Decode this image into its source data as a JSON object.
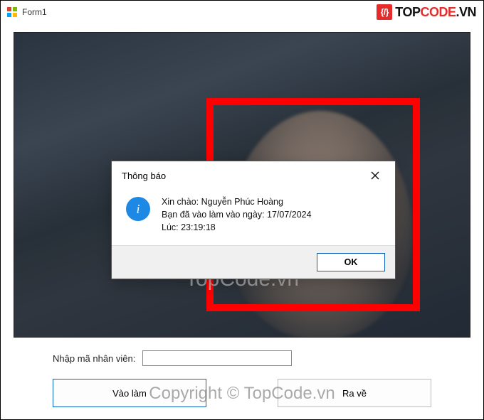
{
  "window": {
    "title": "Form1"
  },
  "brand": {
    "logo_glyph": "{/}",
    "name_part1": "TOP",
    "name_part2": "CODE",
    "name_suffix": ".VN"
  },
  "watermarks": {
    "center": "TopCode.vn",
    "footer": "Copyright © TopCode.vn"
  },
  "form": {
    "input_label": "Nhập mã nhân viên:",
    "input_value": "",
    "input_placeholder": "",
    "btn_checkin": "Vào làm",
    "btn_checkout": "Ra về"
  },
  "dialog": {
    "title": "Thông báo",
    "line1": "Xin chào: Nguyễn Phúc Hoàng",
    "line2": "Bạn đã vào làm vào ngày: 17/07/2024",
    "line3": "Lúc: 23:19:18",
    "ok": "OK"
  }
}
